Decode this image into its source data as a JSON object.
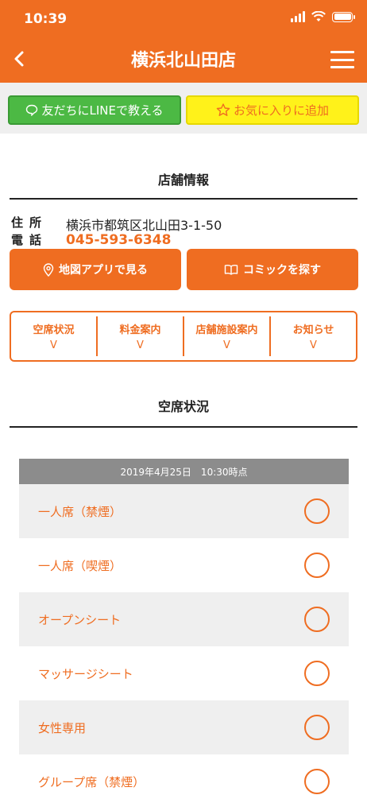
{
  "status_bar": {
    "time": "10:39"
  },
  "header": {
    "title": "横浜北山田店"
  },
  "actions": {
    "line_label": "友だちにLINEで教える",
    "favorite_label": "お気に入りに追加"
  },
  "store_info": {
    "title": "店舗情報",
    "address_label": "住所",
    "address": "横浜市都筑区北山田3-1-50",
    "tel_label": "電話",
    "tel": "045-593-6348",
    "map_button": "地図アプリで見る",
    "comic_button": "コミックを探す"
  },
  "tabs": [
    {
      "label": "空席状況",
      "chevron": "V"
    },
    {
      "label": "料金案内",
      "chevron": "V"
    },
    {
      "label": "店舗施設案内",
      "chevron": "V"
    },
    {
      "label": "お知らせ",
      "chevron": "V"
    }
  ],
  "availability": {
    "title": "空席状況",
    "timestamp": "2019年4月25日　10:30時点",
    "seats": [
      {
        "name": "一人席（禁煙）",
        "status": "○"
      },
      {
        "name": "一人席（喫煙）",
        "status": "○"
      },
      {
        "name": "オープンシート",
        "status": "○"
      },
      {
        "name": "マッサージシート",
        "status": "○"
      },
      {
        "name": "女性専用",
        "status": "○"
      },
      {
        "name": "グループ席（禁煙）",
        "status": "○"
      }
    ]
  },
  "colors": {
    "brand": "#ef6d21",
    "line": "#4cb944",
    "favorite": "#fff21a"
  }
}
